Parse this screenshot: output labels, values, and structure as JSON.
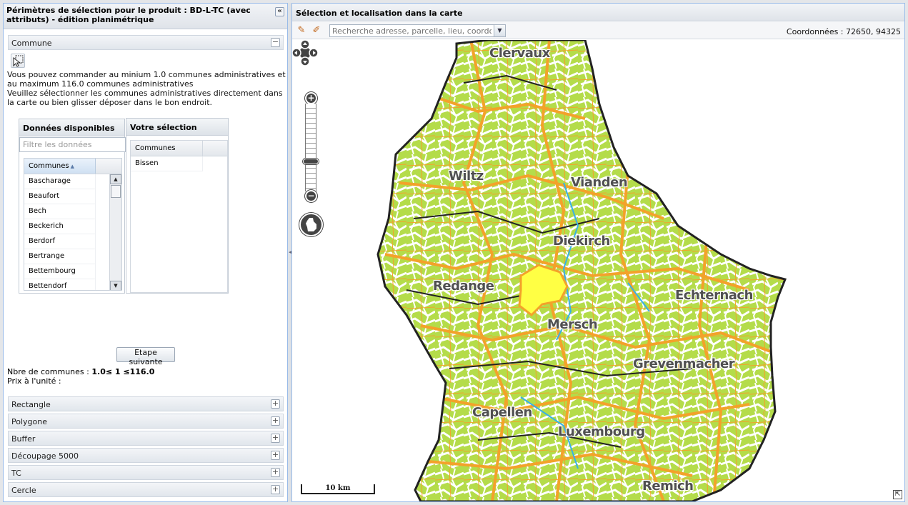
{
  "left": {
    "title": "Périmètres de sélection pour le produit : BD-L-TC (avec attributs) - édition planimétrique",
    "collapse_glyph": "«",
    "sections": {
      "commune": {
        "label": "Commune",
        "toggle": "−"
      },
      "rectangle": {
        "label": "Rectangle",
        "toggle": "+"
      },
      "polygone": {
        "label": "Polygone",
        "toggle": "+"
      },
      "buffer": {
        "label": "Buffer",
        "toggle": "+"
      },
      "decoupage": {
        "label": "Découpage 5000",
        "toggle": "+"
      },
      "tc": {
        "label": "TC",
        "toggle": "+"
      },
      "cercle": {
        "label": "Cercle",
        "toggle": "+"
      }
    },
    "instructions": {
      "line1": "Vous pouvez commander au minium 1.0 communes administratives et au maximum 116.0 communes administratives",
      "line2": "Veuillez sélectionner les communes administratives directement dans la carte ou bien glisser déposer dans le bon endroit."
    },
    "available": {
      "title": "Données disponibles",
      "filter_placeholder": "Filtre les données",
      "column": "Communes",
      "rows": [
        "Bascharage",
        "Beaufort",
        "Bech",
        "Beckerich",
        "Berdorf",
        "Bertrange",
        "Bettembourg",
        "Bettendorf"
      ]
    },
    "selection": {
      "title": "Votre sélection",
      "column": "Communes",
      "rows": [
        "Bissen"
      ]
    },
    "next_button": "Etape suivante",
    "counts": {
      "label": "Nbre de communes : ",
      "value": "1.0≤ 1 ≤116.0",
      "price_label": "Prix à l'unité :"
    }
  },
  "right": {
    "title": "Sélection et localisation dans la carte",
    "search_placeholder": "Recherche adresse, parcelle, lieu, coordonnÃ(",
    "coordinates": "Coordonnées : 72650, 94325",
    "scale": "10 km",
    "map_labels": {
      "clervaux": "Clervaux",
      "wiltz": "Wiltz",
      "vianden": "Vianden",
      "diekirch": "Diekirch",
      "redange": "Redange",
      "echternach": "Echternach",
      "mersch": "Mersch",
      "grevenmacher": "Grevenmacher",
      "capellen": "Capellen",
      "luxembourg": "Luxembourg",
      "remich": "Remich"
    }
  },
  "colors": {
    "accent_border": "#99bbe8",
    "land_green": "#a6d63c",
    "road_orange": "#f3a22a",
    "selected_yellow": "#ffff44"
  }
}
